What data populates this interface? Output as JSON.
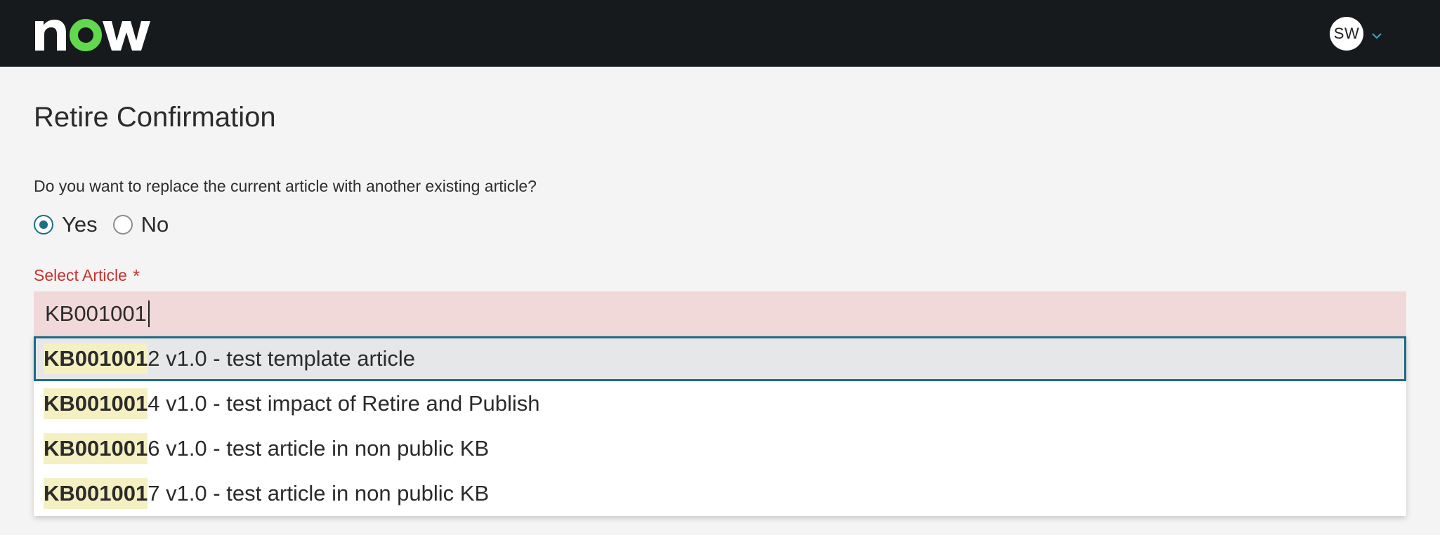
{
  "header": {
    "logo_text": "now",
    "user_initials": "SW"
  },
  "dialog": {
    "title": "Retire Confirmation",
    "question": "Do you want to replace the current article with another existing article?",
    "radio_options": [
      {
        "label": "Yes",
        "checked": true
      },
      {
        "label": "No",
        "checked": false
      }
    ],
    "field_label": "Select Article",
    "required_mark": "*",
    "input_value": "KB001001",
    "suggestions": [
      {
        "match": "KB0010012",
        "rest": "2 v1.0 - test template article",
        "highlight": "KB001001"
      },
      {
        "match": "KB0010014",
        "rest": "4 v1.0 - test impact of Retire and Publish",
        "highlight": "KB001001"
      },
      {
        "match": "KB0010016",
        "rest": "6 v1.0 - test article in non public KB",
        "highlight": "KB001001"
      },
      {
        "match": "KB0010017",
        "rest": "7 v1.0 - test article in non public KB",
        "highlight": "KB001001"
      }
    ]
  },
  "colors": {
    "topbar": "#171a1d",
    "brand_green": "#62d84e",
    "accent": "#1d6d86",
    "error": "#c8322f",
    "input_error_bg": "#f2d9d9",
    "highlight": "#f5f0c2"
  },
  "icons": {
    "logo": "servicenow-logo",
    "user_menu": "chevron-down-icon"
  }
}
